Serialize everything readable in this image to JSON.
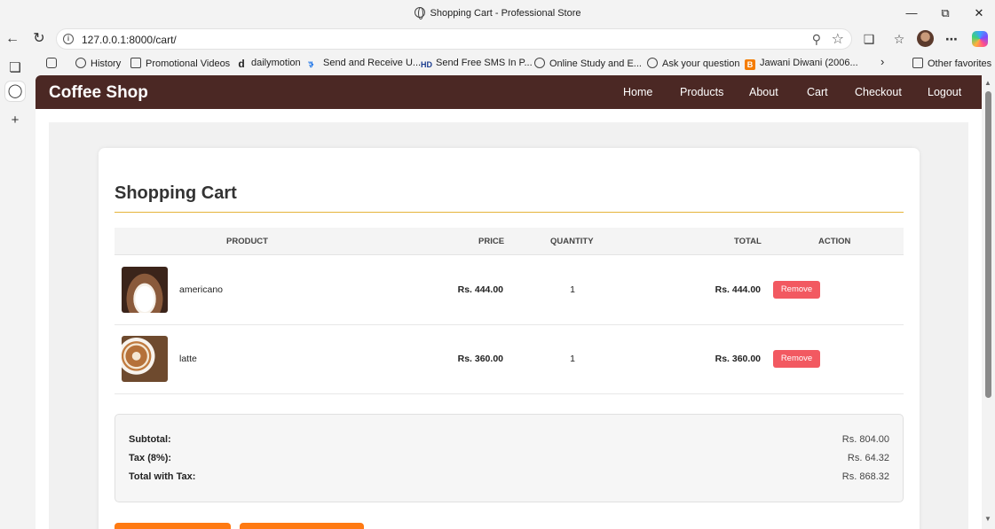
{
  "browser": {
    "window_title": "Shopping Cart - Professional Store",
    "url": "127.0.0.1:8000/cart/",
    "bookmarks": [
      {
        "label": "History",
        "icon": "globe-icon"
      },
      {
        "label": "Promotional Videos",
        "icon": "folder-icon"
      },
      {
        "label": "dailymotion",
        "icon": "dailymotion-icon"
      },
      {
        "label": "Send and Receive U...",
        "icon": "sms-icon"
      },
      {
        "label": "Send Free SMS In P...",
        "icon": "hd-icon"
      },
      {
        "label": "Online Study and E...",
        "icon": "globe-icon"
      },
      {
        "label": "Ask your question",
        "icon": "globe-icon"
      },
      {
        "label": "Jawani Diwani (2006...",
        "icon": "blogger-icon"
      }
    ],
    "other_favorites": "Other favorites"
  },
  "site": {
    "brand": "Coffee Shop",
    "nav": [
      "Home",
      "Products",
      "About",
      "Cart",
      "Checkout",
      "Logout"
    ]
  },
  "cart": {
    "heading": "Shopping Cart",
    "columns": {
      "product": "PRODUCT",
      "price": "PRICE",
      "quantity": "QUANTITY",
      "total": "TOTAL",
      "action": "ACTION"
    },
    "items": [
      {
        "name": "americano",
        "price": "Rs. 444.00",
        "quantity": "1",
        "total": "Rs. 444.00",
        "action": "Remove"
      },
      {
        "name": "latte",
        "price": "Rs. 360.00",
        "quantity": "1",
        "total": "Rs. 360.00",
        "action": "Remove"
      }
    ],
    "summary": {
      "subtotal_label": "Subtotal:",
      "subtotal": "Rs. 804.00",
      "tax_label": "Tax (8%):",
      "tax": "Rs. 64.32",
      "total_label": "Total with Tax:",
      "total": "Rs. 868.32"
    }
  },
  "colors": {
    "navbar": "#4b2824",
    "accent_rule": "#e6b43a",
    "remove": "#f25961",
    "button": "#ff7a12"
  }
}
